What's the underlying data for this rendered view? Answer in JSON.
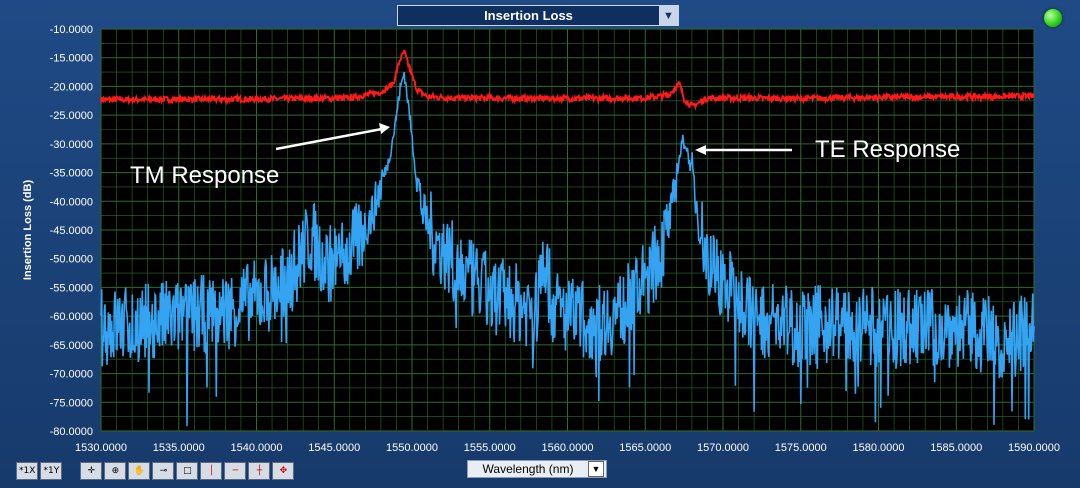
{
  "header": {
    "plot_selector": "Insertion Loss",
    "status_led_color": "#31d21d"
  },
  "xaxis_selector": "Wavelength (nm)",
  "toolbar": {
    "items": [
      "*1X",
      "*1Y",
      "cursor",
      "zoom",
      "pan",
      "probe",
      "rect",
      "vline",
      "hline",
      "cross",
      "move"
    ]
  },
  "chart_data": {
    "type": "line",
    "ylabel": "Insertion Loss (dB)",
    "xlim": [
      1530,
      1590
    ],
    "ylim": [
      -80,
      -10
    ],
    "x_ticks": [
      "1530.0000",
      "1535.0000",
      "1540.0000",
      "1545.0000",
      "1550.0000",
      "1555.0000",
      "1560.0000",
      "1565.0000",
      "1570.0000",
      "1575.0000",
      "1580.0000",
      "1585.0000",
      "1590.0000"
    ],
    "y_ticks": [
      "-10.0000",
      "-15.0000",
      "-20.0000",
      "-25.0000",
      "-30.0000",
      "-35.0000",
      "-40.0000",
      "-45.0000",
      "-50.0000",
      "-55.0000",
      "-60.0000",
      "-65.0000",
      "-70.0000",
      "-75.0000",
      "-80.0000"
    ],
    "grid": true,
    "background": "#000000",
    "grid_color": "#2f6b2a",
    "series": [
      {
        "color": "#ff1a1a",
        "x": [
          1530,
          1540,
          1546,
          1548,
          1548.8,
          1549.2,
          1549.5,
          1549.8,
          1550.3,
          1551,
          1553,
          1560,
          1565,
          1566.5,
          1567.2,
          1567.5,
          1568,
          1569,
          1575,
          1580,
          1590
        ],
        "y": [
          -22.3,
          -22.2,
          -22.0,
          -21.0,
          -19.5,
          -15.5,
          -14.0,
          -16.5,
          -20.5,
          -21.8,
          -22.0,
          -22.1,
          -22.0,
          -21.5,
          -19.5,
          -22.2,
          -23.5,
          -22.0,
          -22.1,
          -21.9,
          -21.7
        ]
      },
      {
        "color": "#33a3f2",
        "x": [
          1530,
          1533,
          1536,
          1538,
          1540,
          1542,
          1543.5,
          1544.5,
          1545.5,
          1546.5,
          1547.5,
          1548,
          1548.5,
          1548.9,
          1549.2,
          1549.5,
          1549.8,
          1550.2,
          1550.7,
          1551.5,
          1552.5,
          1553.5,
          1555,
          1557,
          1558,
          1558.5,
          1559,
          1560,
          1562,
          1563.5,
          1565,
          1566,
          1566.7,
          1567.1,
          1567.4,
          1567.6,
          1568,
          1568.5,
          1569,
          1570,
          1571,
          1572,
          1573.5,
          1575,
          1577,
          1580,
          1585,
          1588,
          1590
        ],
        "y": [
          -62,
          -61,
          -60,
          -59,
          -57,
          -54,
          -46,
          -51,
          -50,
          -47,
          -42,
          -37,
          -33,
          -27,
          -21,
          -17.5,
          -24,
          -34,
          -42,
          -47,
          -50,
          -53,
          -56,
          -58,
          -59,
          -49,
          -58,
          -60,
          -61,
          -59,
          -54,
          -49,
          -42,
          -34,
          -29.5,
          -30,
          -35,
          -44,
          -50,
          -54,
          -57,
          -60,
          -61,
          -62,
          -61,
          -62,
          -62,
          -64,
          -63
        ]
      }
    ],
    "annotations": [
      "TM Response",
      "TE Response"
    ]
  }
}
